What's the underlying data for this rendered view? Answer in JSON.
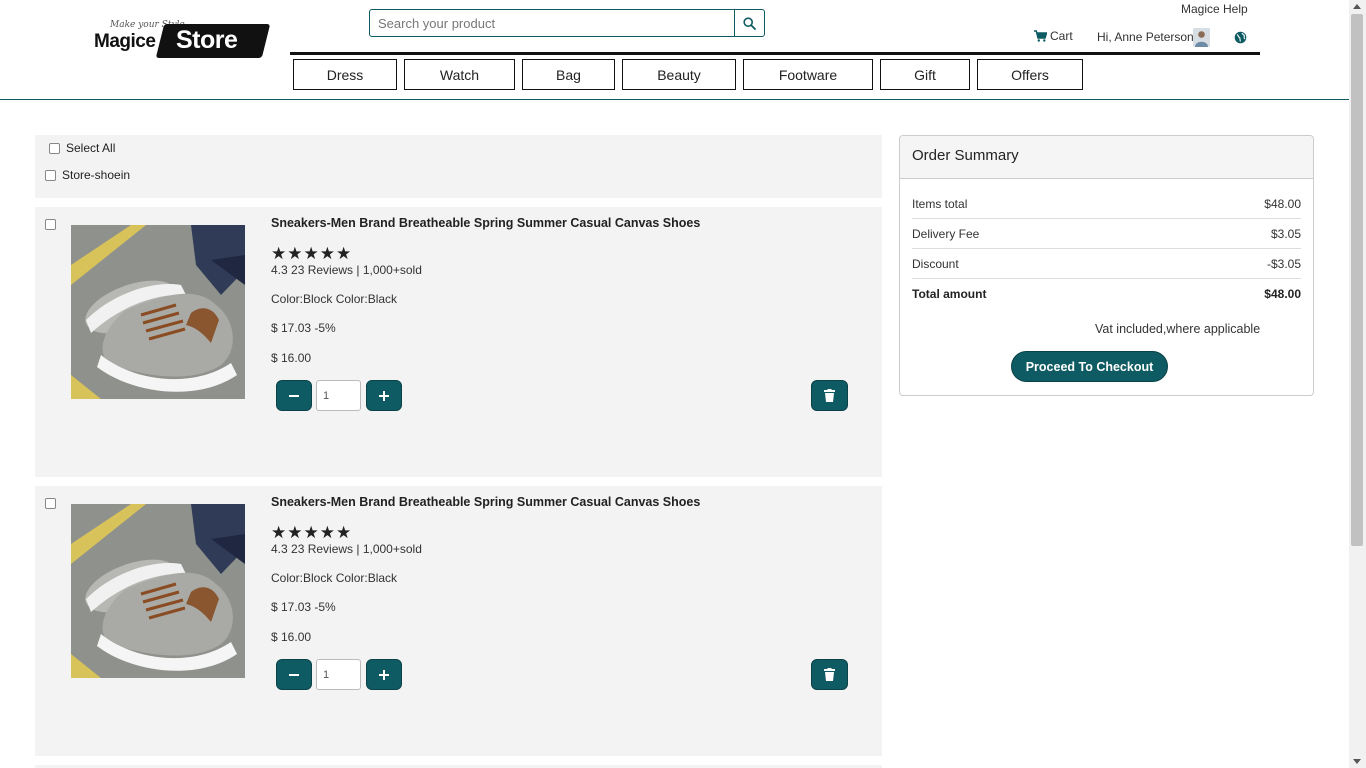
{
  "header": {
    "logo_tagline": "Make your Style",
    "logo_brand": "Magice",
    "logo_store": "Store",
    "search_placeholder": "Search your product",
    "help_link": "Magice Help",
    "cart_label": "Cart",
    "user_greeting": "Hi, Anne Peterson"
  },
  "nav": [
    "Dress",
    "Watch",
    "Bag",
    "Beauty",
    "Footware",
    "Gift",
    "Offers"
  ],
  "selection": {
    "select_all": "Select All",
    "store_name": "Store-shoein"
  },
  "items": [
    {
      "title": "Sneakers-Men Brand Breatheable Spring Summer Casual Canvas Shoes",
      "stars": "★★★★★",
      "rating_line": "4.3 23 Reviews | 1,000+sold",
      "color_line": "Color:Block Color:Black",
      "original_price": "$ 17.03 -5%",
      "price": "$ 16.00",
      "quantity": "1"
    },
    {
      "title": "Sneakers-Men Brand Breatheable Spring Summer Casual Canvas Shoes",
      "stars": "★★★★★",
      "rating_line": "4.3 23 Reviews | 1,000+sold",
      "color_line": "Color:Block Color:Black",
      "original_price": "$ 17.03 -5%",
      "price": "$ 16.00",
      "quantity": "1"
    }
  ],
  "summary": {
    "title": "Order Summary",
    "rows": [
      {
        "label": "Items total",
        "value": "$48.00"
      },
      {
        "label": "Delivery Fee",
        "value": "$3.05"
      },
      {
        "label": "Discount",
        "value": "-$3.05"
      },
      {
        "label": "Total amount",
        "value": "$48.00"
      }
    ],
    "vat_note": "Vat included,where applicable",
    "checkout_label": "Proceed To Checkout"
  },
  "colors": {
    "accent": "#0e5b63",
    "panel": "#f2f3f2"
  }
}
